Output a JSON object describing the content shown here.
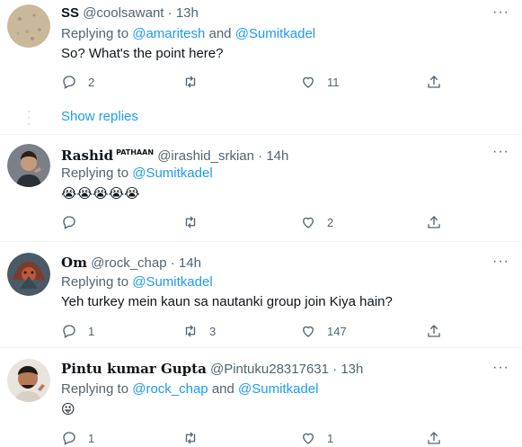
{
  "tweets": [
    {
      "name": "SS",
      "handle": "@coolsawant",
      "time": "13h",
      "replying_prefix": "Replying to",
      "mentions": [
        "@amaritesh",
        "@Sumitkadel"
      ],
      "joiner": "and",
      "text": "So? What's the point here?",
      "replies": "2",
      "retweets": "",
      "likes": "11"
    },
    {
      "name": "Rashid",
      "badge": "PATHAAN",
      "handle": "@irashid_srkian",
      "time": "14h",
      "replying_prefix": "Replying to",
      "mentions": [
        "@Sumitkadel"
      ],
      "text": "😭😭😭😭😭",
      "replies": "",
      "retweets": "",
      "likes": "2"
    },
    {
      "name": "Om",
      "handle": "@rock_chap",
      "time": "14h",
      "replying_prefix": "Replying to",
      "mentions": [
        "@Sumitkadel"
      ],
      "text": "Yeh turkey mein kaun sa nautanki group join Kiya hain?",
      "replies": "1",
      "retweets": "3",
      "likes": "147"
    },
    {
      "name": "Pintu kumar Gupta",
      "handle": "@Pintuku28317631",
      "time": "13h",
      "replying_prefix": "Replying to",
      "mentions": [
        "@rock_chap",
        "@Sumitkadel"
      ],
      "joiner": "and",
      "text": "😜",
      "replies": "1",
      "retweets": "",
      "likes": "1"
    }
  ],
  "show_replies": "Show replies",
  "separator": "·",
  "more_glyph": "···",
  "colors": {
    "link": "#1d9bf0",
    "muted": "#536471",
    "text": "#0f1419",
    "divider": "#eff3f4"
  },
  "icons": [
    "reply-icon",
    "retweet-icon",
    "like-icon",
    "share-icon",
    "more-icon"
  ]
}
